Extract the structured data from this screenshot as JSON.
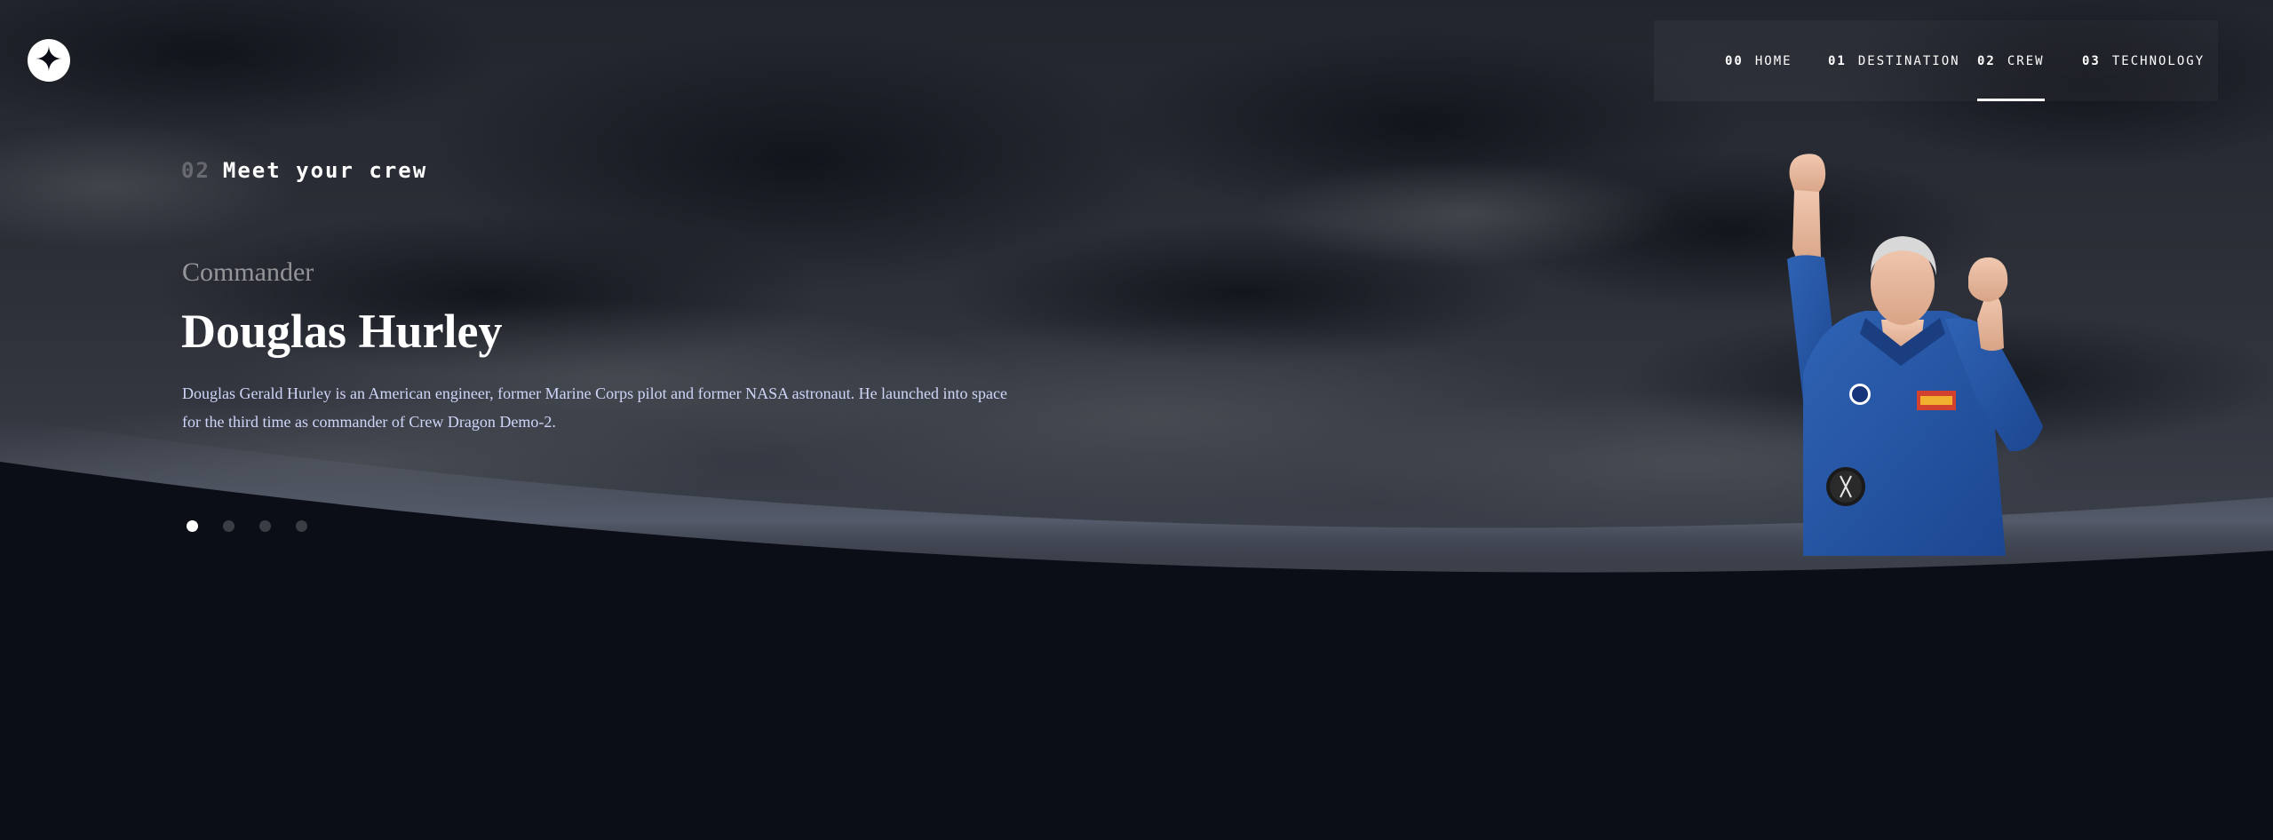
{
  "nav": {
    "items": [
      {
        "num": "00",
        "label": "HOME"
      },
      {
        "num": "01",
        "label": "DESTINATION"
      },
      {
        "num": "02",
        "label": "CREW"
      },
      {
        "num": "03",
        "label": "TECHNOLOGY"
      }
    ],
    "active_index": 2
  },
  "page": {
    "section_num": "02",
    "section_title": "Meet your crew"
  },
  "crew": {
    "role": "Commander",
    "name": "Douglas Hurley",
    "bio": "Douglas Gerald Hurley is an American engineer, former Marine Corps pilot and former NASA astronaut. He launched into space for the third time as commander of Crew Dragon Demo-2."
  },
  "carousel": {
    "count": 4,
    "active_index": 0
  },
  "icons": {
    "logo": "star-logo-icon"
  },
  "colors": {
    "background": "#0b0d17",
    "text": "#ffffff",
    "body_text": "#d0d6f9"
  }
}
